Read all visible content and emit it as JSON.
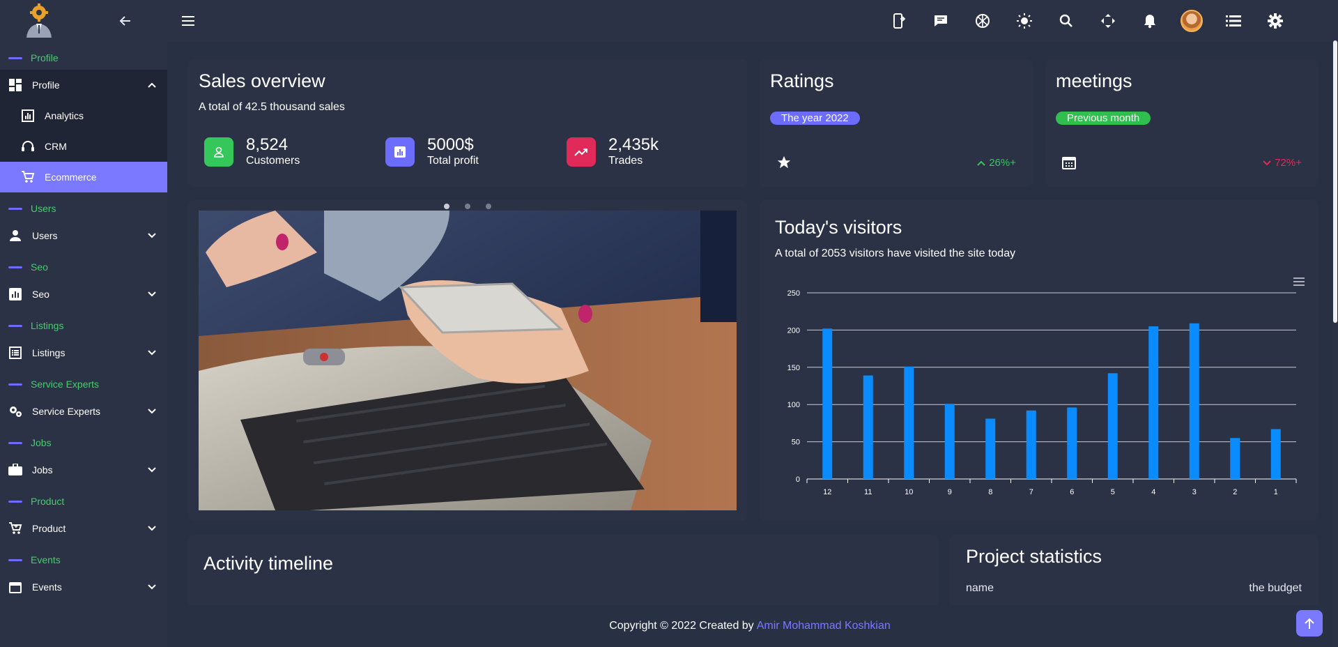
{
  "sidebar": {
    "sections": [
      {
        "label": "Profile",
        "item": "Profile",
        "open": true,
        "subitems": [
          "Analytics",
          "CRM",
          "Ecommerce"
        ],
        "active": "Ecommerce"
      },
      {
        "label": "Users",
        "item": "Users"
      },
      {
        "label": "Seo",
        "item": "Seo"
      },
      {
        "label": "Listings",
        "item": "Listings"
      },
      {
        "label": "Service Experts",
        "item": "Service Experts"
      },
      {
        "label": "Jobs",
        "item": "Jobs"
      },
      {
        "label": "Product",
        "item": "Product"
      },
      {
        "label": "Events",
        "item": "Events"
      }
    ]
  },
  "topbar": {
    "icons": [
      "mobile-icon",
      "chat-icon",
      "language-icon",
      "theme-icon",
      "search-icon",
      "fullscreen-icon",
      "bell-icon",
      "avatar",
      "list-icon",
      "settings-icon"
    ]
  },
  "sales": {
    "title": "Sales overview",
    "subtitle": "A total of 42.5 thousand sales",
    "stats": [
      {
        "value": "8,524",
        "label": "Customers",
        "color": "#35c75a"
      },
      {
        "value": "5000$",
        "label": "Total profit",
        "color": "#6c6cff"
      },
      {
        "value": "2,435k",
        "label": "Trades",
        "color": "#e02a5a"
      }
    ]
  },
  "ratings": {
    "title": "Ratings",
    "pill": "The year 2022",
    "pill_color": "#6c6cff",
    "change": "26%+",
    "change_color": "#35c75a"
  },
  "meetings": {
    "title": "meetings",
    "pill": "Previous month",
    "pill_color": "#2fbf4f",
    "change": "72%+",
    "change_color": "#e02a5a"
  },
  "visitors": {
    "title": "Today's visitors",
    "subtitle": "A total of 2053 visitors have visited the site today"
  },
  "chart_data": {
    "type": "bar",
    "categories": [
      "12",
      "11",
      "10",
      "9",
      "8",
      "7",
      "6",
      "5",
      "4",
      "3",
      "2",
      "1"
    ],
    "values": [
      202,
      139,
      151,
      101,
      81,
      92,
      96,
      142,
      205,
      209,
      55,
      67
    ],
    "ylim": [
      0,
      250
    ],
    "yticks": [
      0,
      50,
      100,
      150,
      200,
      250
    ],
    "grid": true,
    "color": "#0a8cff"
  },
  "activity": {
    "title": "Activity timeline"
  },
  "project": {
    "title": "Project statistics",
    "col_name": "name",
    "col_budget": "the budget"
  },
  "footer": {
    "text": "Copyright © 2022 Created by",
    "author": "Amir Mohammad Koshkian"
  }
}
